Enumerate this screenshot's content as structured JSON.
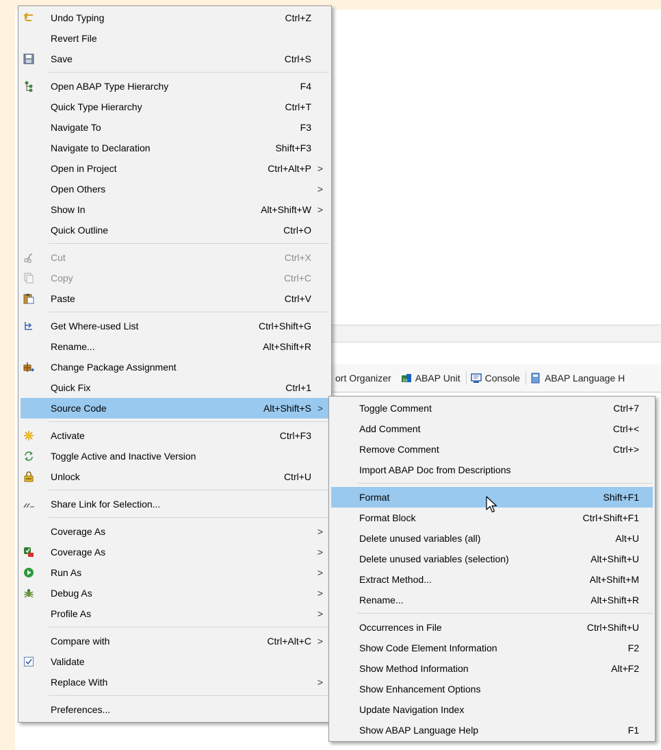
{
  "background_tabs": [
    {
      "label": "ort Organizer",
      "icon": "none"
    },
    {
      "label": "ABAP Unit",
      "icon": "abap-unit-icon"
    },
    {
      "label": "Console",
      "icon": "console-icon"
    },
    {
      "label": "ABAP Language H",
      "icon": "abap-language-help-icon"
    }
  ],
  "context_menu": {
    "items": [
      {
        "label": "Undo Typing",
        "accel": "Ctrl+Z",
        "icon": "undo-icon"
      },
      {
        "label": "Revert File",
        "accel": ""
      },
      {
        "label": "Save",
        "accel": "Ctrl+S",
        "icon": "save-icon"
      },
      {
        "label": "Open ABAP Type Hierarchy",
        "accel": "F4",
        "icon": "type-hierarchy-icon"
      },
      {
        "label": "Quick Type Hierarchy",
        "accel": "Ctrl+T"
      },
      {
        "label": "Navigate To",
        "accel": "F3"
      },
      {
        "label": "Navigate to Declaration",
        "accel": "Shift+F3"
      },
      {
        "label": "Open in Project",
        "accel": "Ctrl+Alt+P",
        "submenu": true
      },
      {
        "label": "Open Others",
        "accel": "",
        "submenu": true
      },
      {
        "label": "Show In",
        "accel": "Alt+Shift+W",
        "submenu": true
      },
      {
        "label": "Quick Outline",
        "accel": "Ctrl+O"
      },
      {
        "label": "Cut",
        "accel": "Ctrl+X",
        "icon": "cut-icon",
        "disabled": true
      },
      {
        "label": "Copy",
        "accel": "Ctrl+C",
        "icon": "copy-icon",
        "disabled": true
      },
      {
        "label": "Paste",
        "accel": "Ctrl+V",
        "icon": "paste-icon"
      },
      {
        "label": "Get Where-used List",
        "accel": "Ctrl+Shift+G",
        "icon": "where-used-icon"
      },
      {
        "label": "Rename...",
        "accel": "Alt+Shift+R"
      },
      {
        "label": "Change Package Assignment",
        "accel": "",
        "icon": "package-icon"
      },
      {
        "label": "Quick Fix",
        "accel": "Ctrl+1"
      },
      {
        "label": "Source Code",
        "accel": "Alt+Shift+S",
        "submenu": true,
        "highlighted": true
      },
      {
        "label": "Activate",
        "accel": "Ctrl+F3",
        "icon": "activate-icon"
      },
      {
        "label": "Toggle Active and Inactive Version",
        "accel": "",
        "icon": "toggle-version-icon"
      },
      {
        "label": "Unlock",
        "accel": "Ctrl+U",
        "icon": "unlock-icon"
      },
      {
        "label": "Share Link for Selection...",
        "accel": "",
        "icon": "share-link-icon"
      },
      {
        "label": "Coverage As",
        "accel": "",
        "submenu": true
      },
      {
        "label": "Coverage As",
        "accel": "",
        "submenu": true,
        "icon": "coverage-icon"
      },
      {
        "label": "Run As",
        "accel": "",
        "submenu": true,
        "icon": "run-icon"
      },
      {
        "label": "Debug As",
        "accel": "",
        "submenu": true,
        "icon": "debug-icon"
      },
      {
        "label": "Profile As",
        "accel": "",
        "submenu": true
      },
      {
        "label": "Compare with",
        "accel": "Ctrl+Alt+C",
        "submenu": true
      },
      {
        "label": "Validate",
        "accel": "",
        "icon": "checkbox-checked-icon",
        "checked": true
      },
      {
        "label": "Replace With",
        "accel": "",
        "submenu": true
      },
      {
        "label": "Preferences...",
        "accel": ""
      }
    ]
  },
  "source_code_submenu": {
    "items": [
      {
        "label": "Toggle Comment",
        "accel": "Ctrl+7"
      },
      {
        "label": "Add Comment",
        "accel": "Ctrl+<"
      },
      {
        "label": "Remove Comment",
        "accel": "Ctrl+>"
      },
      {
        "label": "Import ABAP Doc from Descriptions",
        "accel": ""
      },
      {
        "label": "Format",
        "accel": "Shift+F1",
        "highlighted": true
      },
      {
        "label": "Format Block",
        "accel": "Ctrl+Shift+F1"
      },
      {
        "label": "Delete unused variables (all)",
        "accel": "Alt+U"
      },
      {
        "label": "Delete unused variables (selection)",
        "accel": "Alt+Shift+U"
      },
      {
        "label": "Extract Method...",
        "accel": "Alt+Shift+M"
      },
      {
        "label": "Rename...",
        "accel": "Alt+Shift+R"
      },
      {
        "label": "Occurrences in File",
        "accel": "Ctrl+Shift+U"
      },
      {
        "label": "Show Code Element Information",
        "accel": "F2"
      },
      {
        "label": "Show Method Information",
        "accel": "Alt+F2"
      },
      {
        "label": "Show Enhancement Options",
        "accel": ""
      },
      {
        "label": "Update Navigation Index",
        "accel": ""
      },
      {
        "label": "Show ABAP Language Help",
        "accel": "F1"
      }
    ]
  },
  "submenu_arrow": ">",
  "colors": {
    "highlight": "#99c9ef",
    "menu_bg": "#f2f2f2",
    "disabled_text": "#8c8c8c"
  }
}
